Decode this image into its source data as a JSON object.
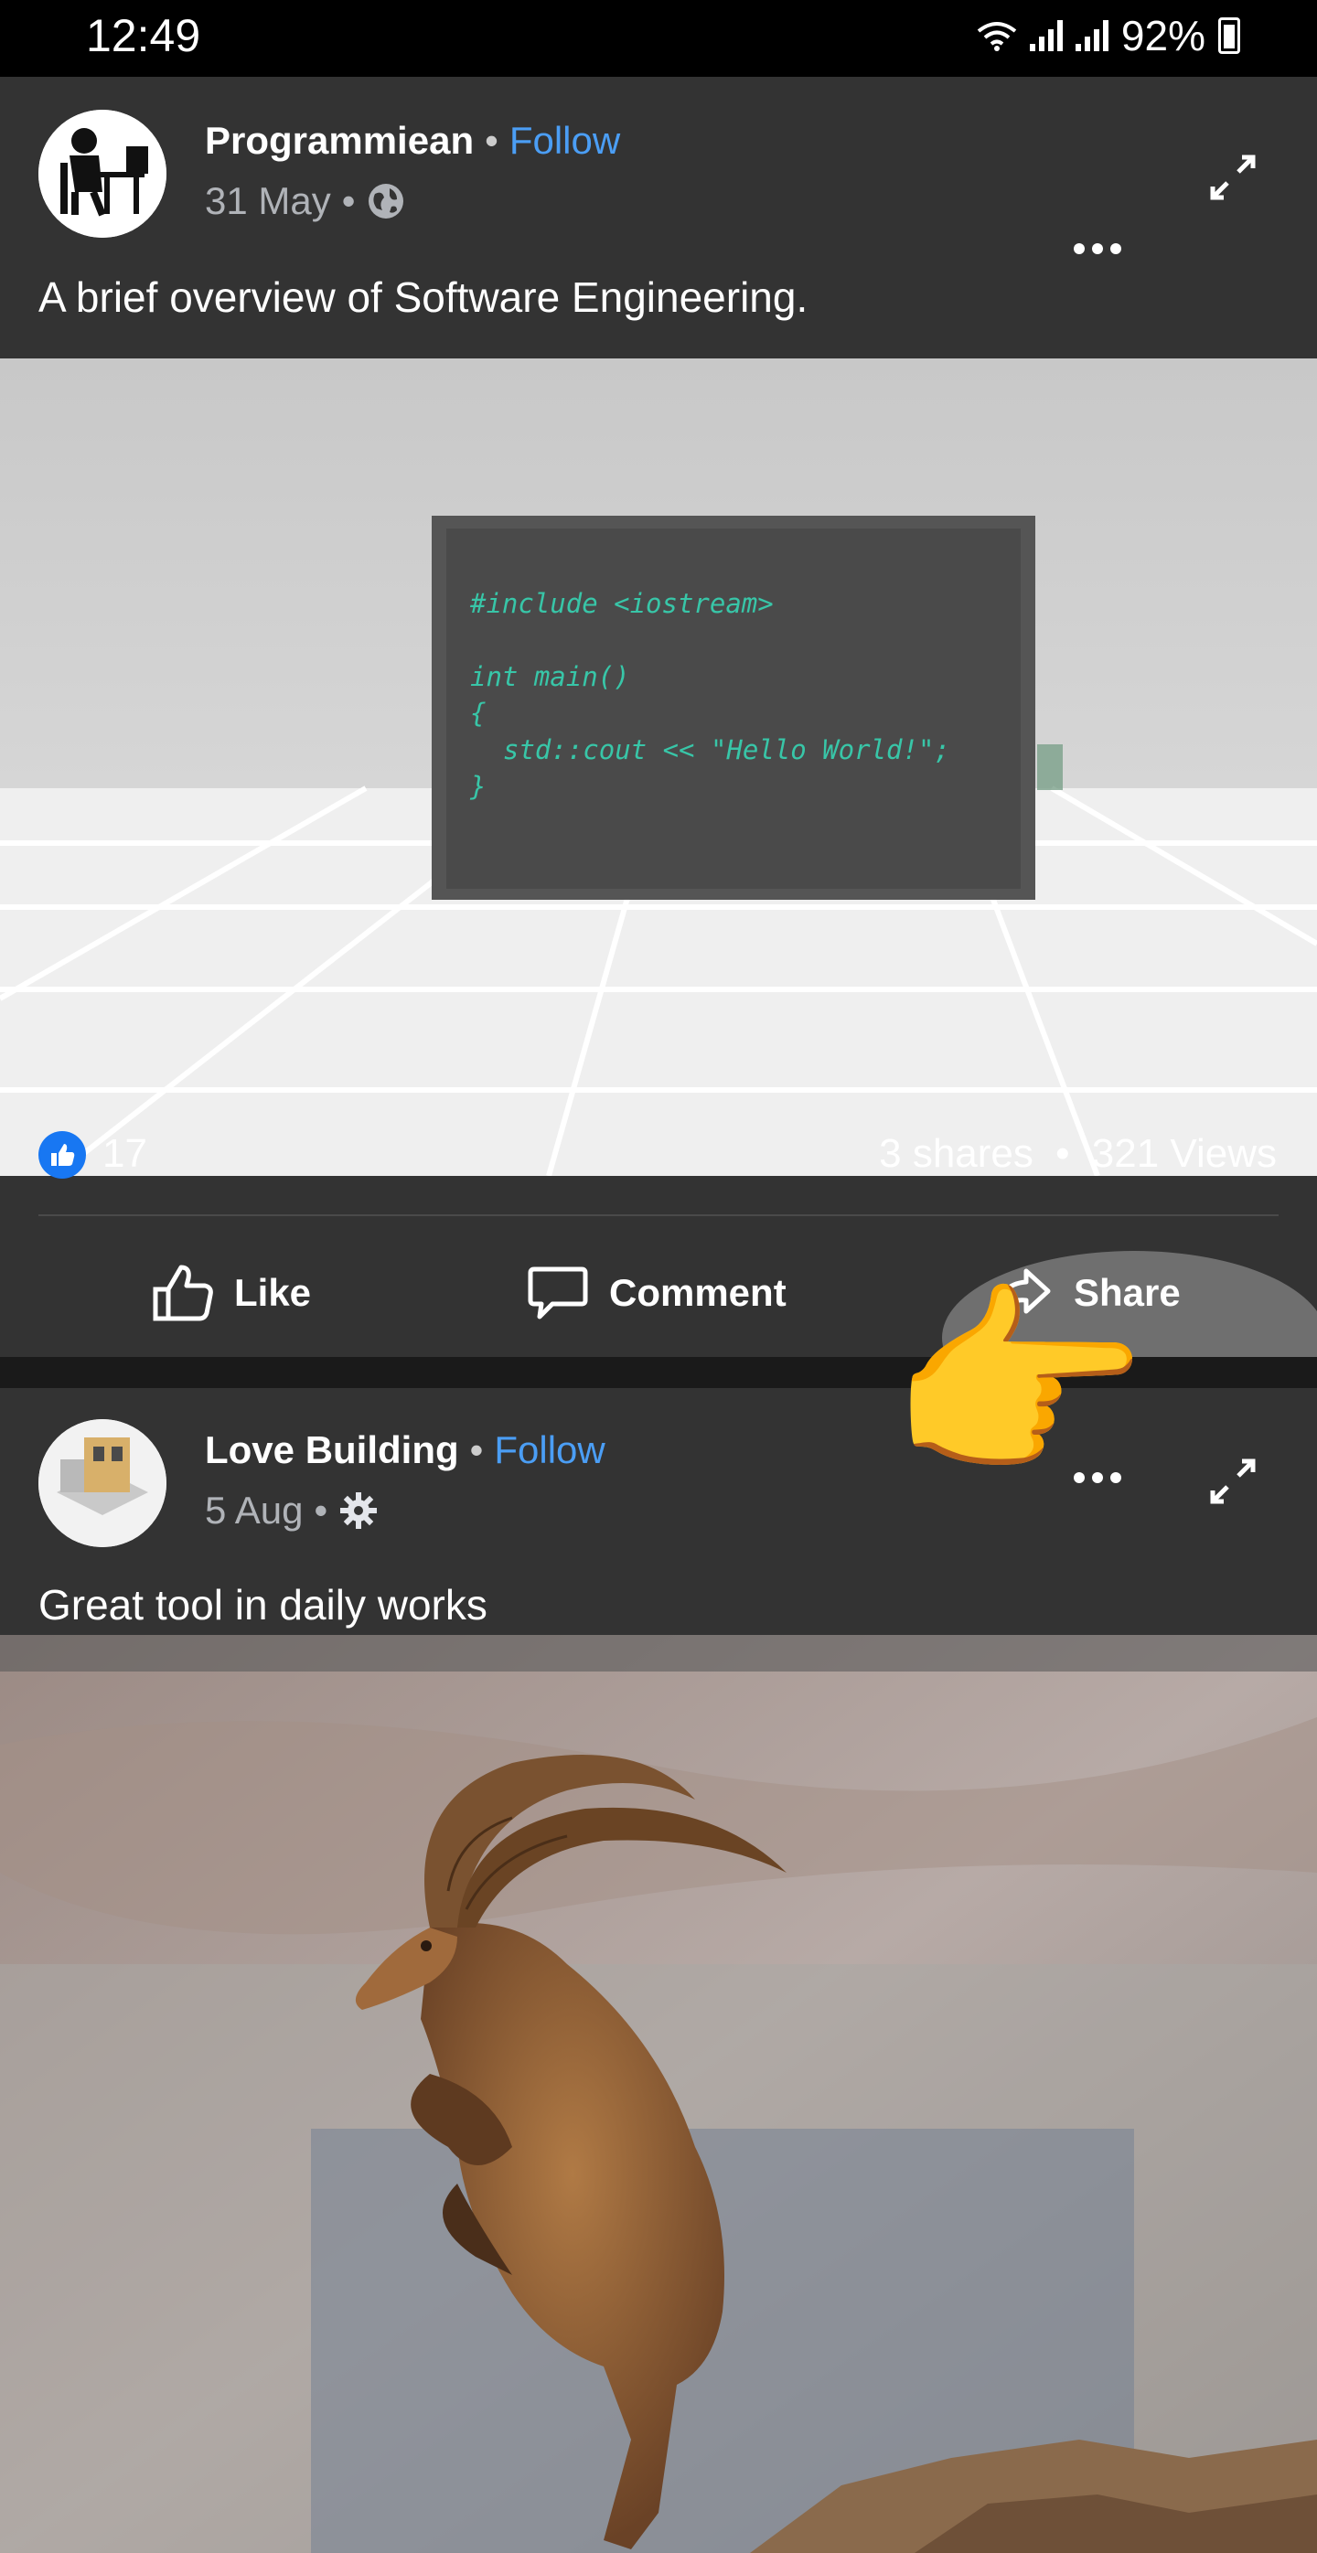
{
  "status_bar": {
    "time": "12:49",
    "battery": "92%"
  },
  "post1": {
    "author": "Programmiean",
    "follow_label": "Follow",
    "date": "31 May",
    "caption": "A brief overview of Software Engineering.",
    "code_lines": [
      "#include <iostream>",
      "int main()",
      "{",
      "std::cout << \"Hello World!\";",
      "}"
    ],
    "like_count": "17",
    "shares": "3 shares",
    "views": "321 Views",
    "actions": {
      "like": "Like",
      "comment": "Comment",
      "share": "Share"
    }
  },
  "post2": {
    "author": "Love Building",
    "follow_label": "Follow",
    "date": "5 Aug",
    "caption": "Great tool in daily works"
  },
  "colors": {
    "card_bg": "#333333",
    "accent": "#4b9ef5",
    "like_blue": "#1877f2"
  }
}
